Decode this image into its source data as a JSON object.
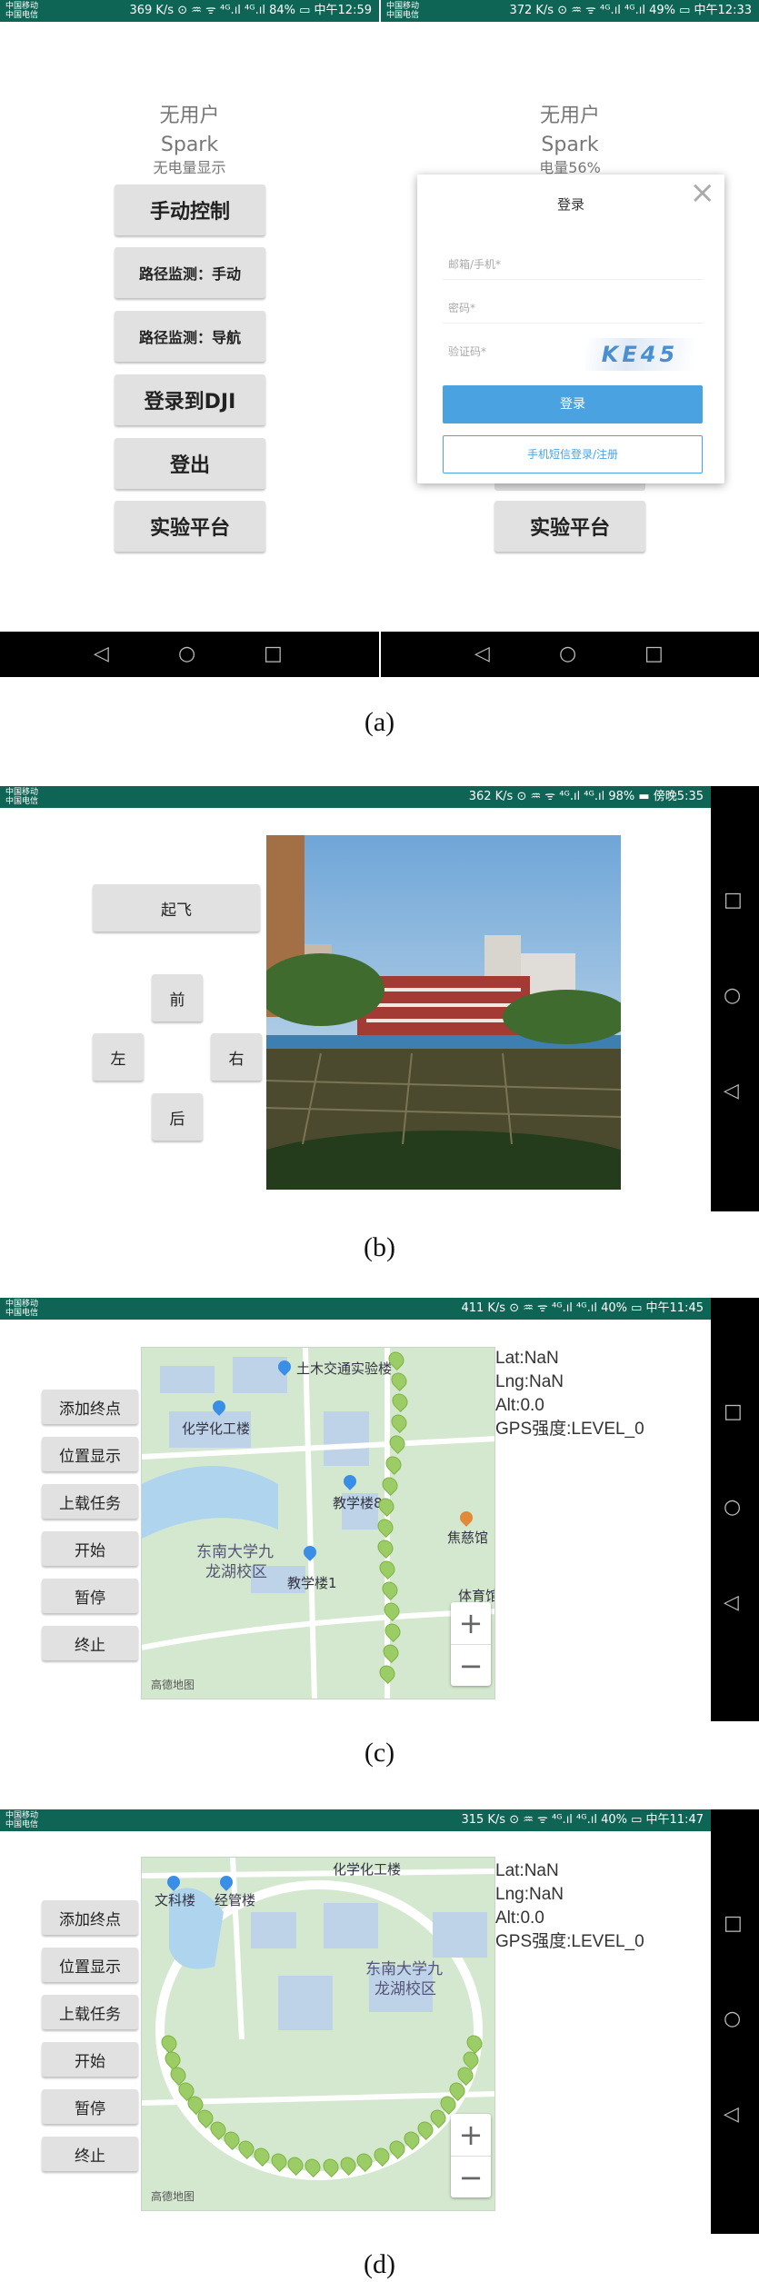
{
  "panel_a": {
    "left": {
      "status_left_top": "中国移动",
      "status_left_bottom": "中国电信",
      "status_right": "369 K/s ⊙ ♒ ᯤ ⁴ᴳ.ıl ⁴ᴳ.ıl 84% ▭ 中午12:59",
      "user": "无用户",
      "aircraft": "Spark",
      "battery": "无电量显示",
      "buttons": [
        "手动控制",
        "路径监测：手动",
        "路径监测：导航",
        "登录到DJI",
        "登出",
        "实验平台"
      ]
    },
    "right": {
      "status_left_top": "中国移动",
      "status_left_bottom": "中国电信",
      "status_right": "372 K/s ⊙ ♒ ᯤ ⁴ᴳ.ıl ⁴ᴳ.ıl 49% ▭ 中午12:33",
      "user": "无用户",
      "aircraft": "Spark",
      "battery": "电量56%",
      "bottom_button": "实验平台",
      "dialog": {
        "title": "登录",
        "close": "×",
        "account_placeholder": "邮箱/手机*",
        "password_placeholder": "密码*",
        "captcha_placeholder": "验证码*",
        "captcha_text": "KE45",
        "login_button": "登录",
        "sms_button": "手机短信登录/注册"
      }
    },
    "nav_icons": [
      "◁",
      "○",
      "□"
    ],
    "caption": "(a)"
  },
  "panel_b": {
    "status_left_top": "中国移动",
    "status_left_bottom": "中国电信",
    "status_right": "362 K/s ⊙ ♒ ᯤ ⁴ᴳ.ıl ⁴ᴳ.ıl 98% ▬ 傍晚5:35",
    "takeoff": "起飞",
    "forward": "前",
    "left": "左",
    "right": "右",
    "back": "后",
    "nav_icons": [
      "□",
      "○",
      "◁"
    ],
    "caption": "(b)"
  },
  "panel_c": {
    "status_left_top": "中国移动",
    "status_left_bottom": "中国电信",
    "status_right": "411 K/s ⊙ ♒ ᯤ ⁴ᴳ.ıl ⁴ᴳ.ıl 40% ▭ 中午11:45",
    "buttons": [
      "添加终点",
      "位置显示",
      "上载任务",
      "开始",
      "暂停",
      "终止"
    ],
    "map_labels": [
      "土木交通实验楼",
      "化学化工楼",
      "教学楼8",
      "东南大学九",
      "龙湖校区",
      "教学楼1",
      "焦慈馆",
      "体育馆"
    ],
    "map_logo": "高德地图",
    "zoom_in": "+",
    "zoom_out": "−",
    "info": [
      "Lat:NaN",
      "Lng:NaN",
      "Alt:0.0",
      "GPS强度:LEVEL_0"
    ],
    "nav_icons": [
      "□",
      "○",
      "◁"
    ],
    "caption": "(c)"
  },
  "panel_d": {
    "status_left_top": "中国移动",
    "status_left_bottom": "中国电信",
    "status_right": "315 K/s ⊙ ♒ ᯤ ⁴ᴳ.ıl ⁴ᴳ.ıl 40% ▭ 中午11:47",
    "buttons": [
      "添加终点",
      "位置显示",
      "上载任务",
      "开始",
      "暂停",
      "终止"
    ],
    "map_labels": [
      "化学化工楼",
      "文科楼",
      "经管楼",
      "东南大学九",
      "龙湖校区"
    ],
    "map_logo": "高德地图",
    "zoom_in": "+",
    "zoom_out": "−",
    "info": [
      "Lat:NaN",
      "Lng:NaN",
      "Alt:0.0",
      "GPS强度:LEVEL_0"
    ],
    "nav_icons": [
      "□",
      "○",
      "◁"
    ],
    "caption": "(d)"
  },
  "colors": {
    "status_bar": "#0e6455",
    "button_bg": "#e1e1e1",
    "login_blue": "#4aa3e0",
    "map_green": "#d6e8d2",
    "waypoint": "#9ccc65"
  }
}
